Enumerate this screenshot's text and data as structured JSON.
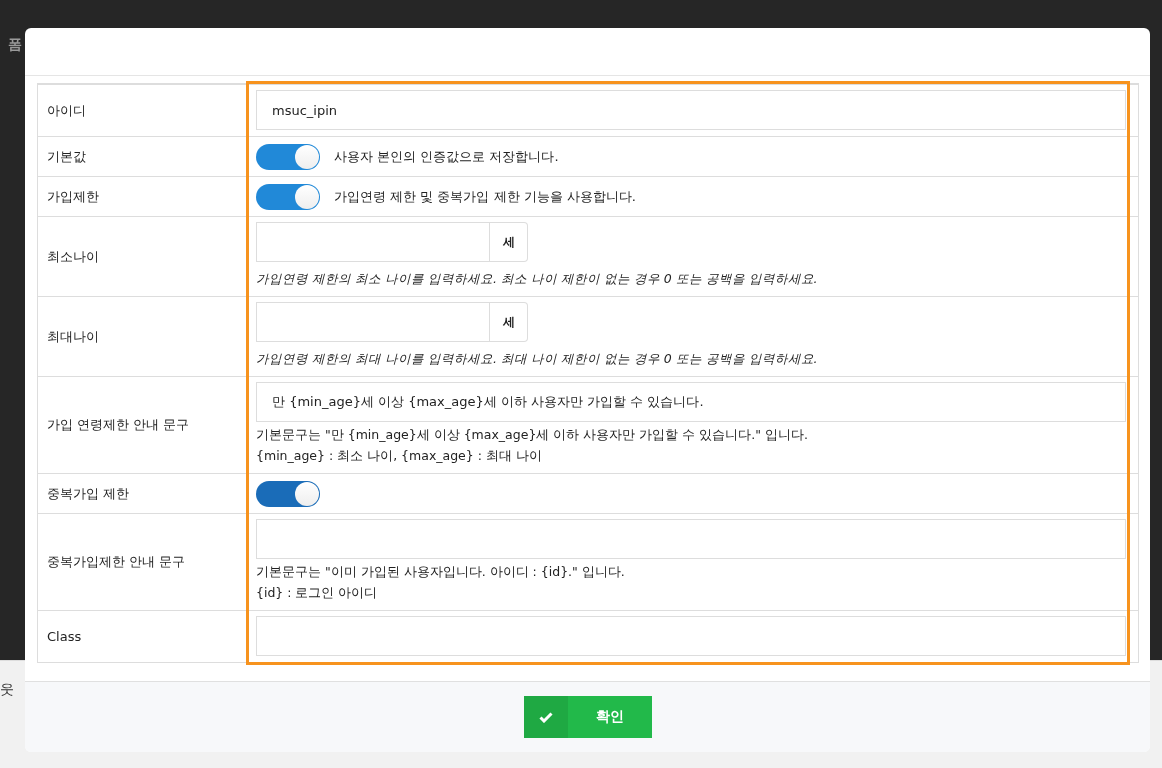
{
  "background": {
    "top_left_text": "폼",
    "bottom_left_text": "웃"
  },
  "form": {
    "rows": [
      {
        "kind": "text",
        "label": "아이디",
        "value": "msuc_ipin"
      },
      {
        "kind": "toggle",
        "label": "기본값",
        "on": true,
        "text": "사용자 본인의 인증값으로 저장합니다."
      },
      {
        "kind": "toggle",
        "label": "가입제한",
        "on": true,
        "text": "가입연령 제한 및 중복가입 제한 기능을 사용합니다."
      },
      {
        "kind": "age",
        "label": "최소나이",
        "value": "",
        "unit": "세",
        "help": "가입연령 제한의 최소 나이를 입력하세요. 최소 나이 제한이 없는 경우 0 또는 공백을 입력하세요."
      },
      {
        "kind": "age",
        "label": "최대나이",
        "value": "",
        "unit": "세",
        "help": "가입연령 제한의 최대 나이를 입력하세요. 최대 나이 제한이 없는 경우 0 또는 공백을 입력하세요."
      },
      {
        "kind": "message",
        "label": "가입 연령제한 안내 문구",
        "value": "만 {min_age}세 이상 {max_age}세 이하 사용자만 가입할 수 있습니다.",
        "notes": [
          "기본문구는 \"만 {min_age}세 이상 {max_age}세 이하 사용자만 가입할 수 있습니다.\" 입니다.",
          "{min_age} : 최소 나이, {max_age} : 최대 나이"
        ]
      },
      {
        "kind": "toggle",
        "label": "중복가입 제한",
        "on": true
      },
      {
        "kind": "message",
        "label": "중복가입제한 안내 문구",
        "value": "",
        "notes": [
          "기본문구는 \"이미 가입된 사용자입니다. 아이디 : {id}.\" 입니다.",
          "{id} : 로그인 아이디"
        ]
      },
      {
        "kind": "text",
        "label": "Class",
        "value": ""
      }
    ]
  },
  "footer": {
    "confirm_button": "확인"
  }
}
